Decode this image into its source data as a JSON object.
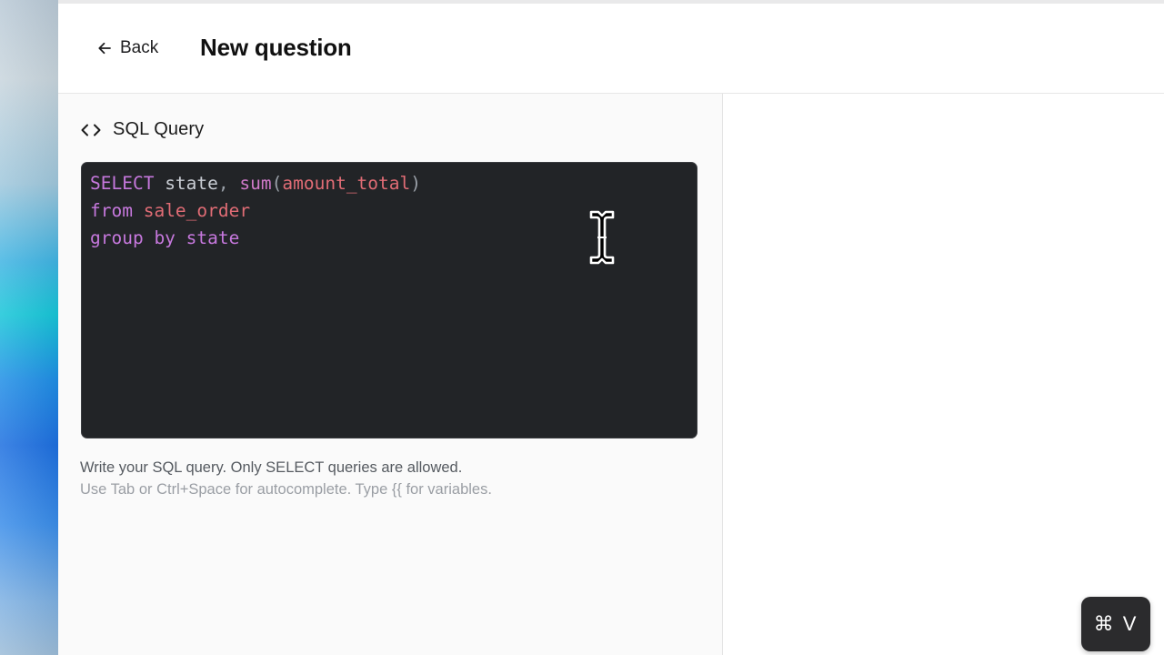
{
  "header": {
    "back_label": "Back",
    "title": "New question"
  },
  "editor": {
    "section_title": "SQL Query",
    "section_icon": "code-brackets-icon",
    "lines": [
      [
        {
          "t": "SELECT",
          "k": "kw"
        },
        {
          "t": " state",
          "k": "plain"
        },
        {
          "t": ",",
          "k": "punct"
        },
        {
          "t": " sum",
          "k": "fn"
        },
        {
          "t": "(",
          "k": "punct"
        },
        {
          "t": "amount_total",
          "k": "id"
        },
        {
          "t": ")",
          "k": "punct"
        }
      ],
      [
        {
          "t": "from",
          "k": "kw"
        },
        {
          "t": " sale_order",
          "k": "id"
        }
      ],
      [
        {
          "t": "group by",
          "k": "kw"
        },
        {
          "t": " state",
          "k": "kw"
        }
      ]
    ],
    "help_text": "Write your SQL query. Only SELECT queries are allowed.",
    "help_subtext": "Use Tab or Ctrl+Space for autocomplete. Type {{ for variables."
  },
  "shortcut": {
    "label": "⌘ V"
  },
  "colors": {
    "editor_bg": "#222427",
    "keyword": "#c678dd",
    "identifier": "#e06c75",
    "panel_bg": "#fafafa"
  },
  "icons": {
    "back": "arrow-left-icon",
    "cursor": "text-cursor-icon"
  }
}
